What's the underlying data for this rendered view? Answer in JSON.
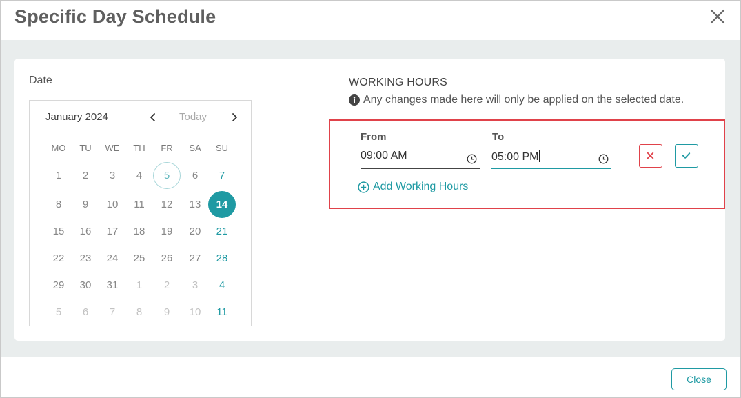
{
  "dialog": {
    "title": "Specific Day Schedule",
    "close_icon": "close-icon"
  },
  "date_section": {
    "label": "Date",
    "calendar": {
      "month_label": "January 2024",
      "today_label": "Today",
      "weekdays": [
        "MO",
        "TU",
        "WE",
        "TH",
        "FR",
        "SA",
        "SU"
      ],
      "weeks": [
        [
          {
            "d": "1"
          },
          {
            "d": "2"
          },
          {
            "d": "3"
          },
          {
            "d": "4"
          },
          {
            "d": "5",
            "state": "today"
          },
          {
            "d": "6"
          },
          {
            "d": "7",
            "state": "sun"
          }
        ],
        [
          {
            "d": "8"
          },
          {
            "d": "9"
          },
          {
            "d": "10"
          },
          {
            "d": "11"
          },
          {
            "d": "12"
          },
          {
            "d": "13"
          },
          {
            "d": "14",
            "state": "selected"
          }
        ],
        [
          {
            "d": "15"
          },
          {
            "d": "16"
          },
          {
            "d": "17"
          },
          {
            "d": "18"
          },
          {
            "d": "19"
          },
          {
            "d": "20"
          },
          {
            "d": "21",
            "state": "sun"
          }
        ],
        [
          {
            "d": "22"
          },
          {
            "d": "23"
          },
          {
            "d": "24"
          },
          {
            "d": "25"
          },
          {
            "d": "26"
          },
          {
            "d": "27"
          },
          {
            "d": "28",
            "state": "sun"
          }
        ],
        [
          {
            "d": "29"
          },
          {
            "d": "30"
          },
          {
            "d": "31"
          },
          {
            "d": "1",
            "state": "muted"
          },
          {
            "d": "2",
            "state": "muted"
          },
          {
            "d": "3",
            "state": "muted"
          },
          {
            "d": "4",
            "state": "sun"
          }
        ],
        [
          {
            "d": "5",
            "state": "muted"
          },
          {
            "d": "6",
            "state": "muted"
          },
          {
            "d": "7",
            "state": "muted"
          },
          {
            "d": "8",
            "state": "muted"
          },
          {
            "d": "9",
            "state": "muted"
          },
          {
            "d": "10",
            "state": "muted"
          },
          {
            "d": "11",
            "state": "sun"
          }
        ]
      ]
    }
  },
  "working_hours": {
    "title": "WORKING HOURS",
    "info_text": "Any changes made here will only be applied on the selected date.",
    "from_label": "From",
    "from_value": "09:00 AM",
    "to_label": "To",
    "to_value": "05:00 PM",
    "add_label": "Add Working Hours"
  },
  "footer": {
    "close_label": "Close"
  },
  "colors": {
    "accent": "#1f9aa3",
    "danger": "#e0424a",
    "body_bg": "#e9eded"
  }
}
